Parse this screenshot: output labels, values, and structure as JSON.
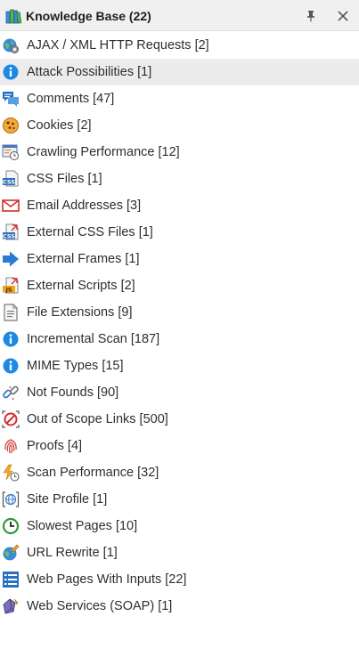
{
  "panel": {
    "title": "Knowledge Base (22)",
    "title_icon": "books-icon",
    "pin_icon": "pin-icon",
    "close_icon": "close-icon"
  },
  "colors": {
    "header_bg": "#f0f0f0",
    "selected_bg": "#ececec",
    "info_blue": "#1e88e5",
    "red": "#d32f2f",
    "green": "#2e9b3a",
    "orange": "#f5a623"
  },
  "items": [
    {
      "label": "AJAX / XML HTTP Requests [2]",
      "icon": "globe-gear-icon"
    },
    {
      "label": "Attack Possibilities [1]",
      "icon": "info-icon",
      "selected": true
    },
    {
      "label": "Comments [47]",
      "icon": "comments-icon"
    },
    {
      "label": "Cookies [2]",
      "icon": "cookie-icon"
    },
    {
      "label": "Crawling Performance [12]",
      "icon": "crawl-performance-icon"
    },
    {
      "label": "CSS Files [1]",
      "icon": "css-file-icon"
    },
    {
      "label": "Email Addresses [3]",
      "icon": "envelope-icon"
    },
    {
      "label": "External CSS Files [1]",
      "icon": "external-css-icon"
    },
    {
      "label": "External Frames [1]",
      "icon": "arrow-right-icon"
    },
    {
      "label": "External Scripts [2]",
      "icon": "external-js-icon"
    },
    {
      "label": "File Extensions [9]",
      "icon": "document-icon"
    },
    {
      "label": "Incremental Scan [187]",
      "icon": "info-icon"
    },
    {
      "label": "MIME Types [15]",
      "icon": "info-icon"
    },
    {
      "label": "Not Founds [90]",
      "icon": "broken-link-icon"
    },
    {
      "label": "Out of Scope Links [500]",
      "icon": "no-entry-icon"
    },
    {
      "label": "Proofs [4]",
      "icon": "fingerprint-icon"
    },
    {
      "label": "Scan Performance [32]",
      "icon": "lightning-clock-icon"
    },
    {
      "label": "Site Profile [1]",
      "icon": "globe-brackets-icon"
    },
    {
      "label": "Slowest Pages [10]",
      "icon": "clock-icon"
    },
    {
      "label": "URL Rewrite [1]",
      "icon": "globe-edit-icon"
    },
    {
      "label": "Web Pages With Inputs [22]",
      "icon": "form-list-icon"
    },
    {
      "label": "Web Services (SOAP) [1]",
      "icon": "soap-icon"
    }
  ]
}
